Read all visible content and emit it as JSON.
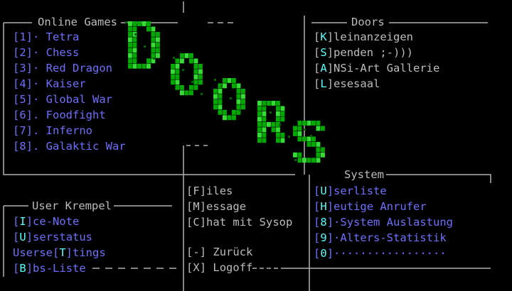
{
  "panels": {
    "online_games": {
      "title": "Online Games",
      "items": [
        {
          "key": "[1]",
          "label": "· Tetra"
        },
        {
          "key": "[2]",
          "label": "· Chess"
        },
        {
          "key": "[3]",
          "label": "· Red Dragon"
        },
        {
          "key": "[4]",
          "label": "· Kaiser"
        },
        {
          "key": "[5]",
          "label": "· Global War"
        },
        {
          "key": "[6]",
          "label": ". Foodfight"
        },
        {
          "key": "[7]",
          "label": ". Inferno"
        },
        {
          "key": "[8]",
          "label": ". Galaktic War"
        }
      ]
    },
    "doors": {
      "title": "Doors",
      "items": [
        {
          "pre": "[",
          "key": "K",
          "post": "]",
          "label": "leinanzeigen"
        },
        {
          "pre": "[",
          "key": "S",
          "post": "]",
          "label": "penden ;-)))"
        },
        {
          "pre": "[",
          "key": "A",
          "post": "]",
          "label": "NSi-Art Gallerie"
        },
        {
          "pre": "[",
          "key": "L",
          "post": "]",
          "label": "esesaal"
        }
      ]
    },
    "user_krempel": {
      "title": "User Krempel",
      "items": [
        {
          "pre": "[",
          "key": "I",
          "post": "]",
          "label": "ce-Note"
        },
        {
          "pre": "[",
          "key": "U",
          "post": "]",
          "label": "serstatus"
        },
        {
          "pre": "Userse[",
          "key": "T",
          "post": "]",
          "label": "tings"
        },
        {
          "pre": "[",
          "key": "B",
          "post": "]",
          "label": "bs-Liste"
        }
      ]
    },
    "center": {
      "items": [
        {
          "pre": "[",
          "key": "F",
          "post": "]",
          "label": "iles"
        },
        {
          "pre": "[",
          "key": "M",
          "post": "]",
          "label": "essage"
        },
        {
          "pre": "[",
          "key": "C",
          "post": "]",
          "label": "hat mit Sysop"
        }
      ],
      "back": {
        "pre": "[",
        "key": "-",
        "post": "]",
        "label": " Zurück"
      },
      "logoff": {
        "pre": "[",
        "key": "X",
        "post": "]",
        "label": " Logoff"
      }
    },
    "system": {
      "title": "System",
      "items": [
        {
          "pre": "[",
          "key": "U",
          "post": "]",
          "label": "serliste"
        },
        {
          "pre": "[",
          "key": "H",
          "post": "]",
          "label": "eutige Anrufer"
        },
        {
          "pre": "[",
          "key": "8",
          "post": "]",
          "label": "·System Auslastung"
        },
        {
          "pre": "[",
          "key": "9",
          "post": "]",
          "label": "·Alters-Statistik"
        },
        {
          "pre": "[",
          "key": "0",
          "post": "]",
          "label": "·················"
        }
      ]
    }
  },
  "logo": {
    "text": "DOORS",
    "color": "#00aa00",
    "highlight": "#33dd33",
    "shadow": "#006600"
  },
  "colors": {
    "background": "#000000",
    "frame": "#b0b0b0",
    "menu_blue": "#6f6fff",
    "key_cyan": "#55ffff",
    "label_gray": "#bcbcbc"
  }
}
